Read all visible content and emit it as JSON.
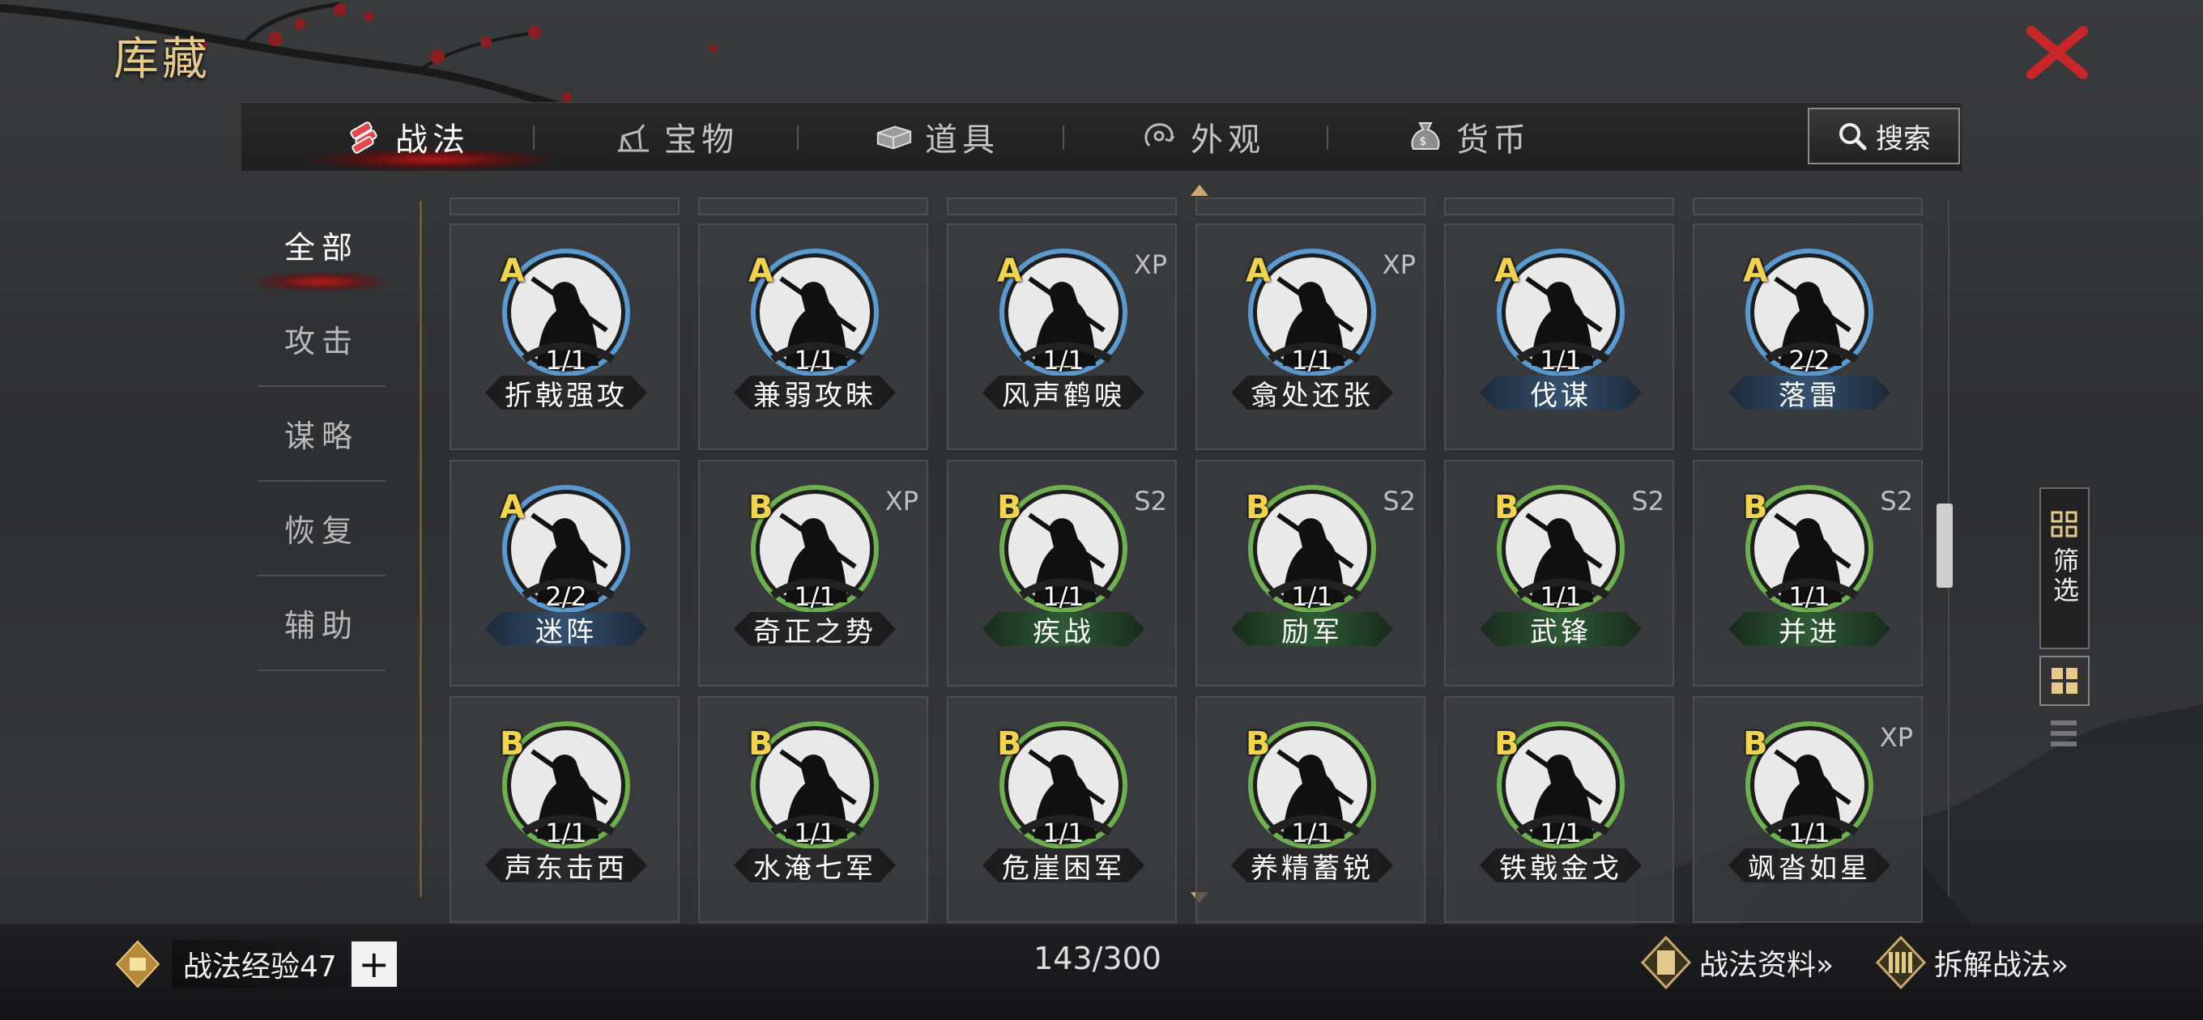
{
  "header": {
    "title": "库藏"
  },
  "tabs": [
    {
      "label": "战法",
      "icon": "skill-scroll-icon",
      "active": true
    },
    {
      "label": "宝物",
      "icon": "treasure-icon",
      "active": false
    },
    {
      "label": "道具",
      "icon": "item-chest-icon",
      "active": false
    },
    {
      "label": "外观",
      "icon": "appearance-icon",
      "active": false
    },
    {
      "label": "货币",
      "icon": "money-bag-icon",
      "active": false
    }
  ],
  "search": {
    "label": "搜索"
  },
  "categories": [
    {
      "label": "全部",
      "active": true
    },
    {
      "label": "攻击",
      "active": false
    },
    {
      "label": "谋略",
      "active": false
    },
    {
      "label": "恢复",
      "active": false
    },
    {
      "label": "辅助",
      "active": false
    }
  ],
  "skills": [
    {
      "grade": "A",
      "tag": "",
      "count": "1/1",
      "name": "折戟强攻",
      "bar": "dark"
    },
    {
      "grade": "A",
      "tag": "",
      "count": "1/1",
      "name": "兼弱攻昧",
      "bar": "dark"
    },
    {
      "grade": "A",
      "tag": "XP",
      "count": "1/1",
      "name": "风声鹤唳",
      "bar": "dark"
    },
    {
      "grade": "A",
      "tag": "XP",
      "count": "1/1",
      "name": "翕处还张",
      "bar": "dark"
    },
    {
      "grade": "A",
      "tag": "",
      "count": "1/1",
      "name": "伐谋",
      "bar": "blue"
    },
    {
      "grade": "A",
      "tag": "",
      "count": "2/2",
      "name": "落雷",
      "bar": "blue"
    },
    {
      "grade": "A",
      "tag": "",
      "count": "2/2",
      "name": "迷阵",
      "bar": "blue"
    },
    {
      "grade": "B",
      "tag": "XP",
      "count": "1/1",
      "name": "奇正之势",
      "bar": "dark"
    },
    {
      "grade": "B",
      "tag": "S2",
      "count": "1/1",
      "name": "疾战",
      "bar": "green"
    },
    {
      "grade": "B",
      "tag": "S2",
      "count": "1/1",
      "name": "励军",
      "bar": "green"
    },
    {
      "grade": "B",
      "tag": "S2",
      "count": "1/1",
      "name": "武锋",
      "bar": "green"
    },
    {
      "grade": "B",
      "tag": "S2",
      "count": "1/1",
      "name": "并进",
      "bar": "green"
    },
    {
      "grade": "B",
      "tag": "",
      "count": "1/1",
      "name": "声东击西",
      "bar": "dark"
    },
    {
      "grade": "B",
      "tag": "",
      "count": "1/1",
      "name": "水淹七军",
      "bar": "dark"
    },
    {
      "grade": "B",
      "tag": "",
      "count": "1/1",
      "name": "危崖困军",
      "bar": "dark"
    },
    {
      "grade": "B",
      "tag": "",
      "count": "1/1",
      "name": "养精蓄锐",
      "bar": "dark"
    },
    {
      "grade": "B",
      "tag": "",
      "count": "1/1",
      "name": "铁戟金戈",
      "bar": "dark"
    },
    {
      "grade": "B",
      "tag": "XP",
      "count": "1/1",
      "name": "飒沓如星",
      "bar": "dark"
    }
  ],
  "filter": {
    "label": "筛选"
  },
  "bottom": {
    "exp_label": "战法经验47",
    "plus": "+",
    "capacity": "143/300",
    "info_link": "战法资料»",
    "dismantle_link": "拆解战法»"
  },
  "colors": {
    "accent_gold": "#e6c98a",
    "grade_yellow": "#f1d34e",
    "ring_blue": "#5a9ad0",
    "ring_green": "#6fb04e",
    "close_red": "#c8262a"
  }
}
